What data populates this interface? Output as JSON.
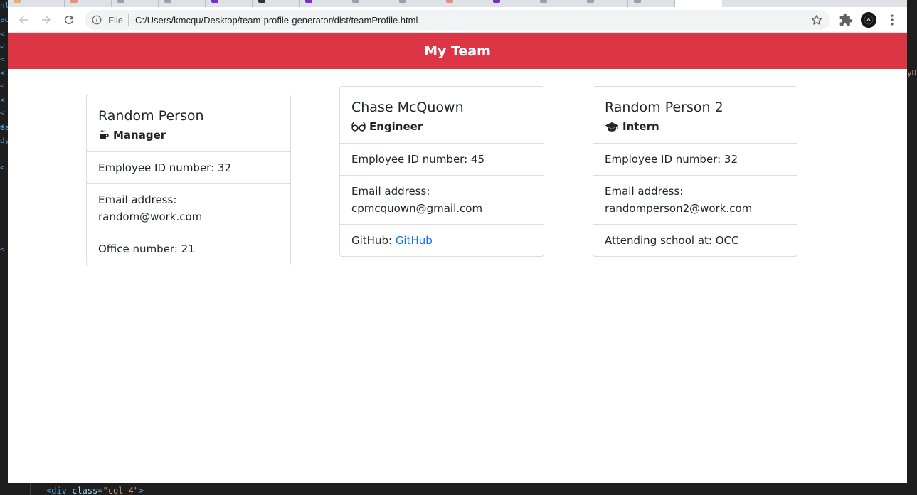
{
  "browser": {
    "file_label": "File",
    "url": "C:/Users/kmcqu/Desktop/team-profile-generator/dist/teamProfile.html"
  },
  "editor": {
    "left_gutter": [
      "nl",
      "ad",
      "<",
      "<",
      "<",
      "<",
      "<",
      "<",
      "<",
      "<",
      "ea",
      "dy",
      "<",
      "<"
    ],
    "right_text": "yD",
    "bottom_code": {
      "tag_open": "<div",
      "attr": " class",
      "eq": "=",
      "value": "\"col-4\"",
      "tag_close": ">"
    }
  },
  "page": {
    "title": "My Team",
    "cards": [
      {
        "name": "Random Person",
        "role": "Manager",
        "icon": "mug-icon",
        "items": [
          {
            "text": "Employee ID number: 32"
          },
          {
            "text": "Email address: random@work.com"
          },
          {
            "text": "Office number: 21"
          }
        ]
      },
      {
        "name": "Chase McQuown",
        "role": "Engineer",
        "icon": "glasses-icon",
        "items": [
          {
            "text": "Employee ID number: 45"
          },
          {
            "text": "Email address: cpmcquown@gmail.com"
          },
          {
            "prefix": "GitHub: ",
            "link": "GitHub"
          }
        ]
      },
      {
        "name": "Random Person 2",
        "role": "Intern",
        "icon": "graduation-cap-icon",
        "items": [
          {
            "text": "Employee ID number: 32"
          },
          {
            "text": "Email address: randomperson2@work.com"
          },
          {
            "text": "Attending school at: OCC"
          }
        ]
      }
    ]
  },
  "colors": {
    "jumbotron": "#dc3545",
    "link": "#0d6efd"
  }
}
